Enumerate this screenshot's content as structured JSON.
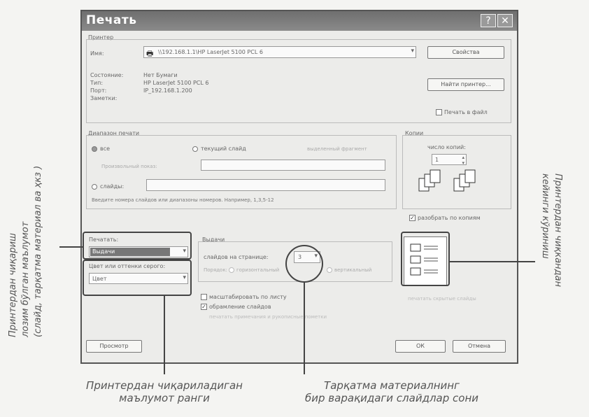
{
  "dialog": {
    "title": "Печать",
    "help_label": "?",
    "close_label": "✕",
    "printer_group": "Принтер",
    "name_label": "Имя:",
    "printer_name": "\\\\192.168.1.1\\HP LaserJet 5100 PCL 6",
    "properties_button": "Свойства",
    "find_printer_button": "Найти принтер...",
    "status_label": "Состояние:",
    "status_value": "Нет Бумаги",
    "type_label": "Тип:",
    "type_value": "HP LaserJet 5100 PCL 6",
    "port_label": "Порт:",
    "port_value": "IP_192.168.1.200",
    "comment_label": "Заметки:",
    "print_to_file": "Печать в файл",
    "range_group": "Диапазон печати",
    "range_all": "все",
    "range_current": "текущий слайд",
    "range_selection": "выделенный фрагмент",
    "range_custom_show": "Произвольный показ:",
    "range_slides": "слайды:",
    "range_hint": "Введите номера слайдов или диапазоны номеров. Например, 1,3,5-12",
    "copies_group": "Копии",
    "copies_count_label": "число копий:",
    "copies_value": "1",
    "collate_label": "разобрать по копиям",
    "print_what_label": "Печатать:",
    "print_what_value": "Выдачи",
    "color_label": "Цвет или оттенки серого:",
    "color_value": "Цвет",
    "handouts_group": "Выдачи",
    "slides_per_page_label": "слайдов на странице:",
    "slides_per_page_value": "3",
    "order_label": "Порядок:",
    "order_horizontal": "горизонтальный",
    "order_vertical": "вертикальный",
    "scale_to_page": "масштабировать по листу",
    "frame_slides": "обрамление слайдов",
    "print_comments": "печатать примечания и рукописные пометки",
    "print_hidden": "печатать скрытые слайды",
    "preview_button": "Просмотр",
    "ok_button": "ОК",
    "cancel_button": "Отмена"
  },
  "annotations": {
    "left_vertical": [
      "Принтердан чиқариш",
      "лозим бўлган маълумот",
      "(слайд, тарқатма материал ва ҳкз )"
    ],
    "right_vertical": [
      "Принтердан чиқкандан",
      "кейинги кўриниш"
    ],
    "bottom_left": [
      "Принтердан чиқариладиган",
      "маълумот ранги"
    ],
    "bottom_right": [
      "Тарқатма материалнинг",
      "бир варақидаги слайдлар сони"
    ]
  }
}
